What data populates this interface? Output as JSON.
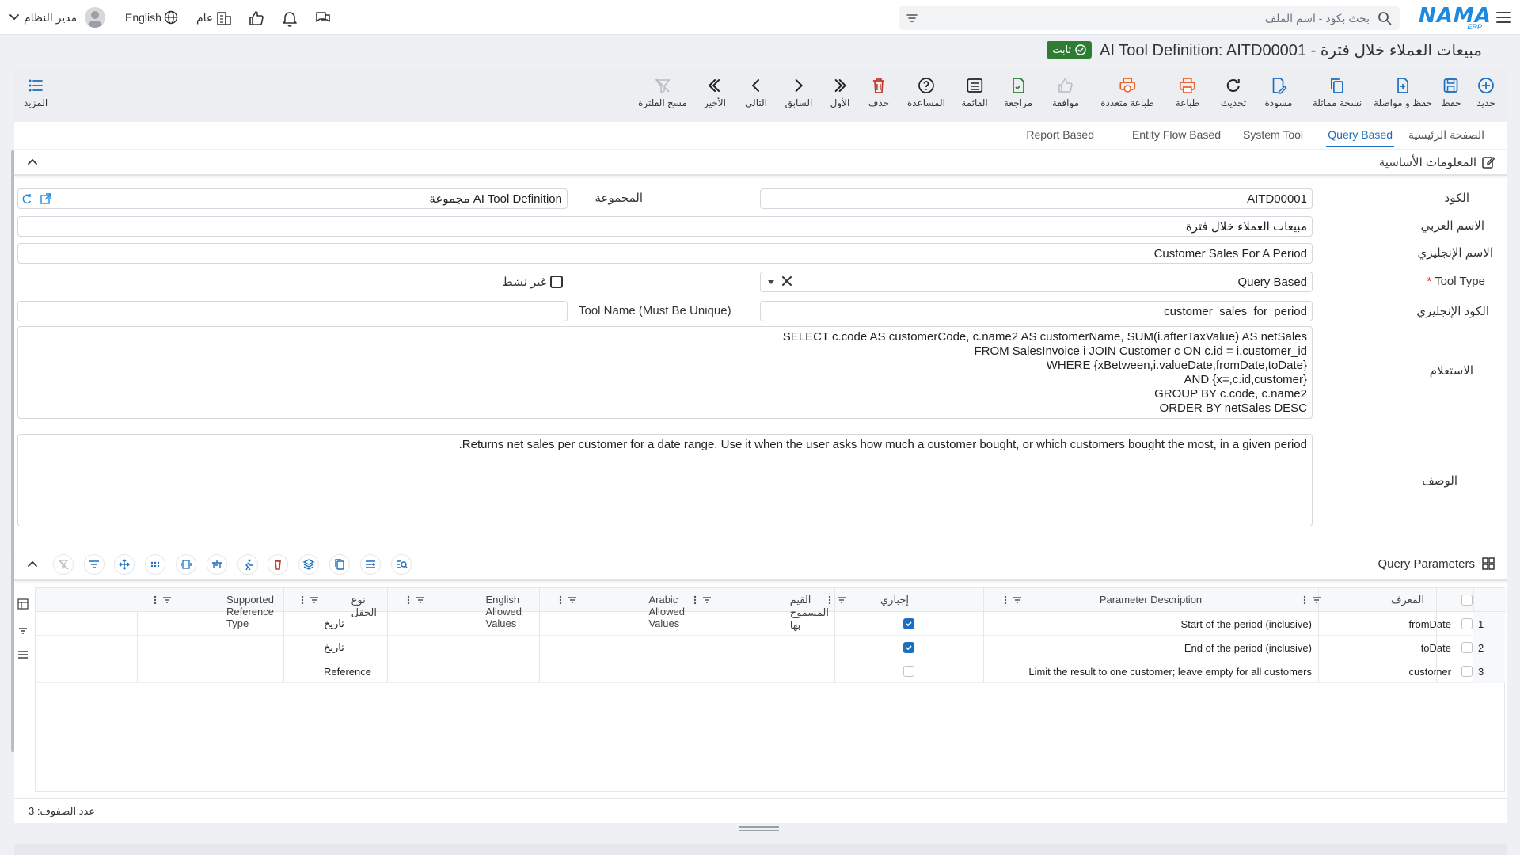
{
  "topbar": {
    "search_placeholder": "بحث بكود - اسم الملف",
    "language": "English",
    "scope": "عام",
    "user": "مدير النظام"
  },
  "title": {
    "text": "AI Tool Definition: AITD00001 - مبيعات العملاء خلال فترة",
    "status": "ثابت"
  },
  "toolbar": {
    "items": [
      {
        "label": "جديد",
        "icon": "plus-circle-icon"
      },
      {
        "label": "حفظ",
        "icon": "save-icon"
      },
      {
        "label": "حفظ و مواصلة",
        "icon": "save-continue-icon"
      },
      {
        "label": "نسخة مماثلة",
        "icon": "duplicate-icon"
      },
      {
        "label": "مسودة",
        "icon": "draft-icon"
      },
      {
        "label": "تحديث",
        "icon": "refresh-icon"
      },
      {
        "label": "طباعة",
        "icon": "print-icon"
      },
      {
        "label": "طباعة متعددة",
        "icon": "multi-print-icon"
      },
      {
        "label": "موافقة",
        "icon": "thumb-up-icon"
      },
      {
        "label": "مراجعة",
        "icon": "review-icon"
      },
      {
        "label": "القائمة",
        "icon": "list-icon"
      },
      {
        "label": "المساعدة",
        "icon": "help-icon"
      },
      {
        "label": "حذف",
        "icon": "trash-icon"
      },
      {
        "label": "الأول",
        "icon": "first-icon"
      },
      {
        "label": "السابق",
        "icon": "previous-icon"
      },
      {
        "label": "التالي",
        "icon": "next-icon"
      },
      {
        "label": "الأخير",
        "icon": "last-icon"
      },
      {
        "label": "مسح الفلترة",
        "icon": "clear-filter-icon"
      }
    ],
    "more": "المزيد"
  },
  "tabs": [
    "الصفحة الرئيسية",
    "Query Based",
    "System Tool",
    "Entity Flow Based",
    "Report Based"
  ],
  "section": {
    "title": "المعلومات الأساسية"
  },
  "form": {
    "code_label": "الكود",
    "code_value": "AITD00001",
    "group_label": "المجموعة",
    "group_value": "مجموعة AI Tool Definition",
    "arabic_name_label": "الاسم العربي",
    "arabic_name_value": "مبيعات العملاء خلال فترة",
    "english_name_label": "الاسم الإنجليزي",
    "english_name_value": "Customer Sales For A Period",
    "tool_type_label": "Tool Type",
    "tool_type_required": "*",
    "tool_type_value": "Query Based",
    "inactive_label": "غير نشط",
    "english_code_label": "الكود الإنجليزي",
    "english_code_value": "customer_sales_for_period",
    "tool_name_label": "Tool Name (Must Be Unique)",
    "tool_name_value": "",
    "query_label": "الاستعلام",
    "query_lines": [
      "SELECT c.code AS customerCode, c.name2 AS customerName, SUM(i.afterTaxValue) AS netSales",
      "FROM SalesInvoice i JOIN Customer c ON c.id = i.customer_id",
      "WHERE {xBetween,i.valueDate,fromDate,toDate}",
      "AND {x=,c.id,customer}",
      "GROUP BY c.code, c.name2",
      "ORDER BY netSales DESC"
    ],
    "description_label": "الوصف",
    "description_value": "Returns net sales per customer for a date range. Use it when the user asks how much a customer bought, or which customers bought the most, in a given period."
  },
  "grid": {
    "title": "Query Parameters",
    "headers": {
      "id": "المعرف",
      "description": "Parameter Description",
      "required": "إجباري",
      "allowed": "القيم المسموح بها",
      "arabic_allowed": "Arabic Allowed Values",
      "english_allowed": "English Allowed Values",
      "field_type": "نوع الحقل",
      "ref_type": "Supported Reference Type"
    },
    "rows": [
      {
        "num": "1",
        "id": "fromDate",
        "description": "Start of the period (inclusive)",
        "required": true,
        "field_type": "تاريخ"
      },
      {
        "num": "2",
        "id": "toDate",
        "description": "End of the period (inclusive)",
        "required": true,
        "field_type": "تاريخ"
      },
      {
        "num": "3",
        "id": "customer",
        "description": "Limit the result to one customer; leave empty for all customers",
        "required": false,
        "field_type": "Reference"
      }
    ],
    "row_count": "عدد الصفوف: 3"
  },
  "colors": {
    "accent": "#1b6fbf",
    "brand": "#1b8ae0",
    "badge": "#2e7d32",
    "delete": "#c0392b",
    "print": "#e8622c"
  }
}
